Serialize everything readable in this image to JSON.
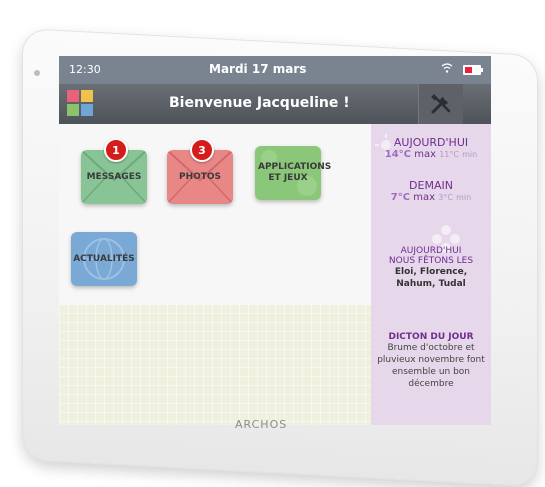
{
  "device": {
    "brand": "ARCHOS"
  },
  "statusbar": {
    "time": "12:30",
    "date": "Mardi 17 mars",
    "wifi_icon": "wifi-icon",
    "battery_icon": "battery-low-icon"
  },
  "titlebar": {
    "welcome": "Bienvenue Jacqueline !",
    "tools_icon": "tools-icon"
  },
  "apps": [
    {
      "label": "MESSAGES",
      "badge": "1",
      "color": "#88c495"
    },
    {
      "label": "PHOTOS",
      "badge": "3",
      "color": "#e98787"
    },
    {
      "label": "APPLICATIONS ET JEUX",
      "badge": "",
      "color": "#8bc778"
    },
    {
      "label": "ACTUALITÉS",
      "badge": "",
      "color": "#7aa9d6"
    }
  ],
  "sidebar": {
    "today": {
      "heading": "AUJOURD'HUI",
      "max": "14°C",
      "max_suffix": "max",
      "min": "11°C",
      "min_suffix": "min"
    },
    "tomorrow": {
      "heading": "DEMAIN",
      "max": "7°C",
      "max_suffix": "max",
      "min": "3°C",
      "min_suffix": "min"
    },
    "names": {
      "heading_line1": "AUJOURD'HUI",
      "heading_line2": "NOUS FÊTONS LES",
      "list_line1": "Eloi, Florence,",
      "list_line2": "Nahum, Tudal"
    },
    "dicton": {
      "heading": "DICTON DU JOUR",
      "line1": "Brume d'octobre et",
      "line2": "pluvieux novembre font",
      "line3": "ensemble un bon",
      "line4": "décembre"
    }
  }
}
